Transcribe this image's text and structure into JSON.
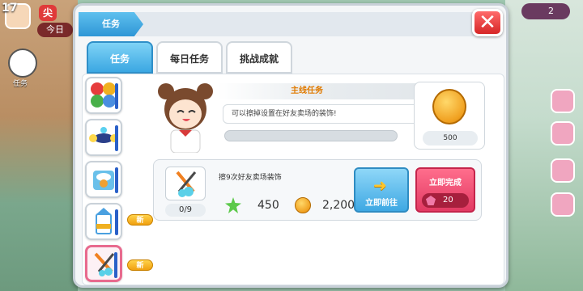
{
  "hud": {
    "level": "17",
    "today_label": "今日",
    "tasks_label": "任务",
    "gem_count": "2"
  },
  "panel": {
    "header_label": "任务",
    "close_icon": "close-x-icon"
  },
  "tabs": [
    {
      "label": "任务",
      "active": true
    },
    {
      "label": "每日任务",
      "active": false
    },
    {
      "label": "挑战成就",
      "active": false
    }
  ],
  "sidebar": {
    "new_badge": "新",
    "items": [
      {
        "icon": "chars-tile-icon"
      },
      {
        "icon": "drone-icon"
      },
      {
        "icon": "food-box-icon"
      },
      {
        "icon": "milk-carton-icon"
      },
      {
        "icon": "broom-icon"
      }
    ]
  },
  "main_task": {
    "title": "主线任务",
    "description": "可以擦掉设置在好友卖场的装饰!",
    "progress": 0,
    "reward_amount": "500"
  },
  "task": {
    "name": "擦9次好友卖场装饰",
    "count": "0/9",
    "stars": "450",
    "coins": "2,200",
    "go_label": "立即前往",
    "complete_label": "立即完成",
    "complete_cost": "20"
  },
  "colors": {
    "accent_blue": "#3ba7e2",
    "accent_red": "#e23a63",
    "title_orange": "#e07a00"
  }
}
